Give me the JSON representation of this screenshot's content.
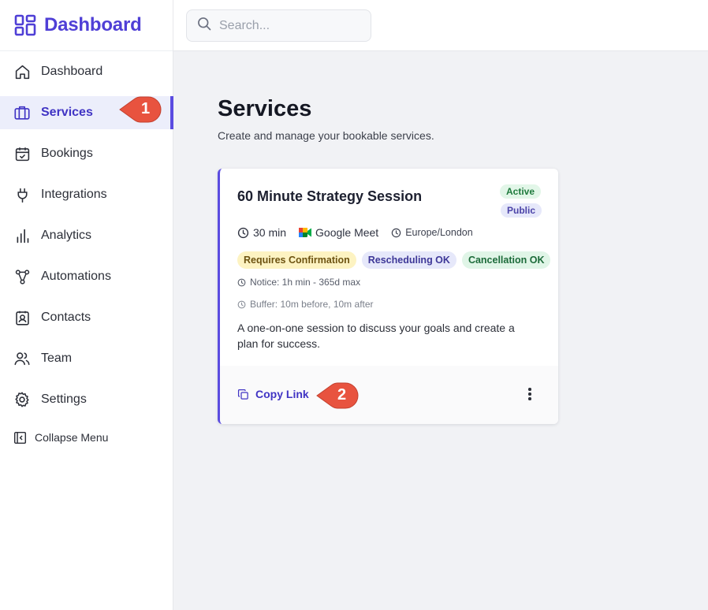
{
  "brand": {
    "title": "Dashboard",
    "icon": "grid-logo-icon",
    "color": "#4f3fd6"
  },
  "search": {
    "placeholder": "Search..."
  },
  "sidebar": {
    "items": [
      {
        "label": "Dashboard",
        "icon": "home-icon"
      },
      {
        "label": "Services",
        "icon": "briefcase-icon",
        "active": true
      },
      {
        "label": "Bookings",
        "icon": "calendar-check-icon"
      },
      {
        "label": "Integrations",
        "icon": "plug-icon"
      },
      {
        "label": "Analytics",
        "icon": "bar-chart-icon"
      },
      {
        "label": "Automations",
        "icon": "workflow-icon"
      },
      {
        "label": "Contacts",
        "icon": "contact-card-icon"
      },
      {
        "label": "Team",
        "icon": "users-icon"
      },
      {
        "label": "Settings",
        "icon": "gear-icon"
      }
    ],
    "collapse_label": "Collapse Menu"
  },
  "page": {
    "title": "Services",
    "subtitle": "Create and manage your bookable services."
  },
  "service": {
    "title": "60 Minute Strategy Session",
    "badges": {
      "active": "Active",
      "public": "Public"
    },
    "duration": "30 min",
    "location": "Google Meet",
    "timezone": "Europe/London",
    "pills": [
      "Requires Confirmation",
      "Rescheduling OK",
      "Cancellation OK"
    ],
    "notice": "Notice: 1h min - 365d max",
    "buffer": "Buffer: 10m before, 10m after",
    "description": "A one-on-one session to discuss your goals and create a plan for success.",
    "copy_link_label": "Copy Link"
  },
  "callouts": [
    "1",
    "2"
  ],
  "colors": {
    "accent": "#5b4ce0",
    "callout": "#e8533f"
  }
}
